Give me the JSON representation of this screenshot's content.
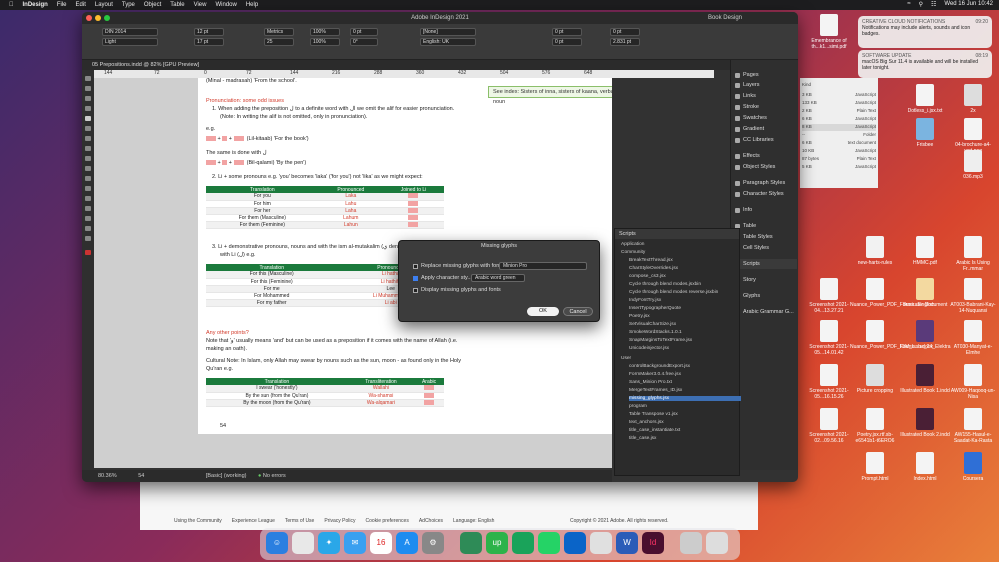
{
  "menubar": {
    "app": "InDesign",
    "items": [
      "File",
      "Edit",
      "Layout",
      "Type",
      "Object",
      "Table",
      "View",
      "Window",
      "Help"
    ],
    "clock": "Wed 16 Jun 10:42"
  },
  "window": {
    "title": "Adobe InDesign 2021",
    "workspace": "Book Design",
    "doc_tab": "05 Prepositions.indd @ 82% [GPU Preview]"
  },
  "control": {
    "font": "DIN 2014",
    "style": "Light",
    "size": "12 pt",
    "leading": "17 pt",
    "kerning": "Metrics",
    "tracking": "25",
    "h_scale": "100%",
    "v_scale": "100%",
    "baseline": "0 pt",
    "skew": "0°",
    "char_style": "[None]",
    "language": "English: UK",
    "indent1": "0 pt",
    "indent2": "0 pt",
    "indent3": "0 pt",
    "indent4": "2.831 pt"
  },
  "ruler": [
    "144",
    "72",
    "0",
    "72",
    "144",
    "216",
    "288",
    "360",
    "432",
    "504",
    "576",
    "648"
  ],
  "page": {
    "line1": "(Minal - madrasah) 'From the school'.",
    "heading1": "Pronunciation: some odd issues",
    "p1": "1.  When adding the preposition ل to a definite word with ال we omit the alif for easier pronunciation.",
    "p1b": "(Note: In writing the alif is not omitted, only in pronunciation).",
    "eg": "e.g.",
    "ex1": "(Lil-kitaab)  'For the book')",
    "same": "The same is done with ل",
    "ex2": "(Bil-qalami)  'By the pen')",
    "p2": "2.  Li + some pronouns e.g. 'you' becomes 'laka' ('for you') not 'lika' as we might expect:",
    "t1_headers": [
      "Translation",
      "Pronounced",
      "Joined to Li"
    ],
    "t1_rows": [
      [
        "For you",
        "Laka"
      ],
      [
        "For him",
        "Lahu"
      ],
      [
        "For her",
        "Laha"
      ],
      [
        "For them (Masculine)",
        "Lahum"
      ],
      [
        "For them (Feminine)",
        "Lahun"
      ]
    ],
    "p3": "3.  Li + demonstrative pronouns, nouns and with the ism al-mutakalim (ي denoting 'me') is pronounced",
    "p3b": "with Li (ل) e.g.",
    "t2_headers": [
      "Translation",
      "Pronounced"
    ],
    "t2_rows": [
      [
        "For this (Masculine)",
        "Li hatha"
      ],
      [
        "For this (Feminine)",
        "Li hathihi"
      ],
      [
        "For me",
        "Lee"
      ],
      [
        "For Mohammed",
        "Li Muhammadin"
      ],
      [
        "For my father",
        "Li abi"
      ]
    ],
    "heading2": "Any other points?",
    "p4": "Note that 'و' usually means 'and' but can be used as a preposition if it comes with the name of Allah (i.e.",
    "p4b": "making an oath).",
    "p5": "Cultural Note: In Islam, only Allah may swear by nouns such as the sun, moon - as found only in the Holy",
    "p5b": "Qu'ran e.g.",
    "t3_headers": [
      "Translation",
      "Transliteration",
      "Arabic"
    ],
    "t3_rows": [
      [
        "I swear  ('honestly')",
        "Wallahi"
      ],
      [
        "By the sun  (from the Qu'ran)",
        "Wa-shamsi"
      ],
      [
        "By the moon  (from the Qu'ran)",
        "Wa-alqamari"
      ]
    ],
    "page_number": "54"
  },
  "note": "See index: Sisters of inna, sisters of kaana, verbal noun",
  "status": {
    "zoom": "80.36%",
    "page": "54",
    "style": "[Basic] (working)",
    "errors": "No errors"
  },
  "panels": [
    "Pages",
    "Layers",
    "Links",
    "Stroke",
    "Swatches",
    "Gradient",
    "CC Libraries",
    "Effects",
    "Object Styles",
    "Paragraph Styles",
    "Character Styles",
    "Info",
    "Table",
    "Table Styles",
    "Cell Styles",
    "Scripts",
    "Story",
    "Glyphs",
    "Arabic Grammar G..."
  ],
  "scripts": {
    "title": "Scripts",
    "rows": [
      "Application",
      "Community",
      "BreakTextThread.jsx",
      "CharStyleOverrides.jsx",
      "compose_cs3.jsx",
      "Cycle through blend modes.jsxbin",
      "Cycle through blend modes reverse.jsxbin",
      "IndyFontTry.jsx",
      "InsertTypographerQuote",
      "Poetry.jsx",
      "SetVisualCharSize.jsx",
      "SmokeWordStacks.1.0.1",
      "SnapMarginsToTextFrame.jsx",
      "Unicodeinjector.jsx",
      "User",
      "controlBackgroundExport.jsx",
      "FormMaker3.0.4.free.jsx",
      "Sans_Minion Pro.txt",
      "MergeTextFrames_ID.jsx",
      "missing_glyphs.jsx",
      "program",
      "Table Transpose v1.jsx",
      "text_anchors.jsx",
      "title_case_instantiate.txt",
      "title_case.jsx"
    ],
    "selected": "missing_glyphs.jsx"
  },
  "dialog": {
    "title": "Missing glyphs",
    "opt1": "Replace missing glyphs with font:",
    "font": "Minion Pro",
    "opt2": "Apply character sty...",
    "char_style": "Arabic word green",
    "opt3": "Display missing glyphs and fonts",
    "ok": "OK",
    "cancel": "Cancel"
  },
  "finder": [
    [
      "Kind",
      ""
    ],
    [
      "3 KB",
      "JavaScript"
    ],
    [
      "133 KB",
      "JavaScript"
    ],
    [
      "2 KB",
      "Plain Text"
    ],
    [
      "6 KB",
      "JavaScript"
    ],
    [
      "8 KB",
      "JavaScript"
    ],
    [
      "--",
      "Folder"
    ],
    [
      "6 KB",
      "text document"
    ],
    [
      "10 KB",
      "JavaScript"
    ],
    [
      "87 bytes",
      "Plain Text"
    ],
    [
      "5 KB",
      "JavaScript"
    ]
  ],
  "notifications": [
    {
      "app": "CREATIVE CLOUD NOTIFICATIONS",
      "time": "09:20",
      "text": "Notifications may include alerts, sounds and icon badges."
    },
    {
      "app": "SOFTWARE UPDATE",
      "time": "08:19",
      "text": "macOS Big Sur 11.4 is available and will be installed later tonight."
    }
  ],
  "desktop": [
    "Emembrance of th...k1...simi.pdf",
    "Dotless_i.jsx.txt",
    "2x",
    "Frisbee",
    "04-brochure-a4-vert.png",
    "036.mp3",
    "new-harts-rules",
    "HMMC.pdf",
    "Arabic Is Using Fr..mmar",
    "Screenshot 2021-04...13.27.21",
    "Nuance_Power_PDF_Forms...English",
    "Illustrator Document",
    "AT003-Babrani-Kay-14-Nuquansi",
    "Screenshot 2021-05...14.01.42",
    "Nuance_Power_PDF_Forms...h.docx",
    "IDM_Issue_24_Elektra",
    "AT030-Manyat-e-Elmhe",
    "Screenshot 2021-05...16.15.26",
    "Picture cropping",
    "Illustrated Book 1.indd",
    "AW009-Haqooq-un-Nisa",
    "Screenshot 2021-02...09.56.16",
    "Poetry.jsx.rtf.sb-e6541b1-t6ERO6",
    "Illustrated Book 2.indd",
    "AW155-Hasul-e-Saadat-Ka-Rasta",
    "Prompt.html",
    "Index.html",
    "Coursera"
  ],
  "footer": [
    "Using the Community",
    "Experience League",
    "Terms of Use",
    "Privacy Policy",
    "Cookie preferences",
    "AdChoices",
    "Language: English",
    "Copyright © 2021 Adobe. All rights reserved."
  ],
  "colors": {
    "table_header": "#1b7a3c",
    "accent_red": "#d23b2b",
    "dialog_ok": "#3d7ff0"
  }
}
